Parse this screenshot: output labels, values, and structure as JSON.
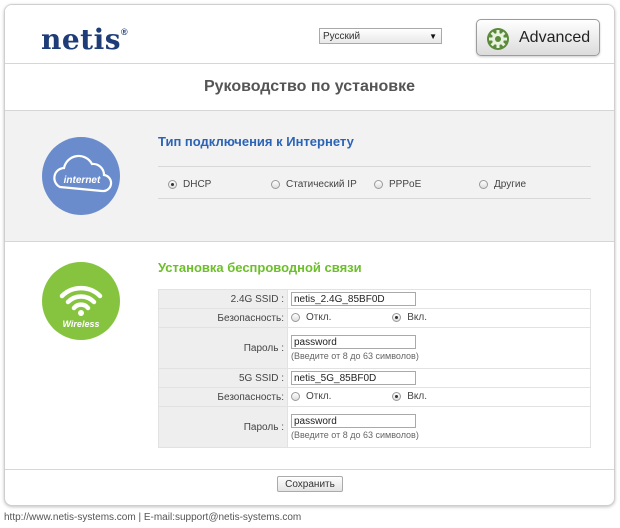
{
  "header": {
    "logo": "netis",
    "logo_mark": "®",
    "language_selected": "Русский",
    "advanced_label": "Advanced"
  },
  "page_title": "Руководство по установке",
  "internet": {
    "icon_label": "internet",
    "title": "Тип подключения к Интернету",
    "options": [
      {
        "label": "DHCP",
        "checked": true
      },
      {
        "label": "Статический IP",
        "checked": false
      },
      {
        "label": "PPPoE",
        "checked": false
      },
      {
        "label": "Другие",
        "checked": false
      }
    ]
  },
  "wireless": {
    "icon_label": "Wireless",
    "title": "Установка беспроводной связи",
    "ssid24_label": "2.4G SSID :",
    "ssid24_value": "netis_2.4G_85BF0D",
    "security_label": "Безопасность:",
    "off_label": "Откл.",
    "on_label": "Вкл.",
    "password_label": "Пароль :",
    "password24_value": "password",
    "password_hint": "(Введите от 8 до 63 символов)",
    "ssid5_label": "5G SSID :",
    "ssid5_value": "netis_5G_85BF0D",
    "password5_value": "password"
  },
  "save_label": "Сохранить",
  "footer": "http://www.netis-systems.com | E-mail:support@netis-systems.com",
  "colors": {
    "accent_blue": "#2b63b5",
    "accent_green": "#6cbf2a",
    "logo": "#1d3c78"
  }
}
